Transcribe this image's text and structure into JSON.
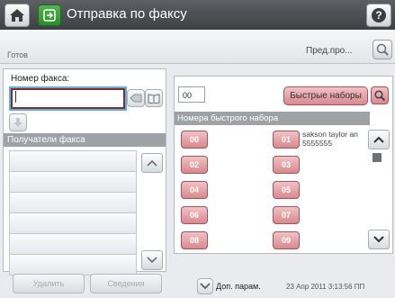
{
  "titlebar": {
    "title": "Отправка по факсу"
  },
  "status": {
    "text": "Готов",
    "preview_label": "Пред.про..."
  },
  "fax": {
    "number_label": "Номер факса:",
    "number_value": ""
  },
  "recipients": {
    "header": "Получатели факса",
    "rows": [
      "",
      "",
      "",
      "",
      "",
      ""
    ]
  },
  "bottom": {
    "delete_label": "Удалить",
    "details_label": "Сведения",
    "more_options_label": "Доп. парам.",
    "datetime": "23 Апр 2011 3:13:56 ПП"
  },
  "speed_dial": {
    "input_value": "00",
    "quick_button_label": "Быстрые наборы",
    "header": "Номера быстрого набора",
    "buttons": [
      "00",
      "01",
      "02",
      "03",
      "04",
      "05",
      "06",
      "07",
      "08",
      "09"
    ],
    "entry_01_line1": "sakson taylor an",
    "entry_01_line2": "5555555"
  },
  "colors": {
    "titlebar": "#4a4c4f",
    "speed_dial_button": "#d9888e",
    "focus_ring": "#5fb2e0",
    "header_gray": "#9ea2a7"
  }
}
